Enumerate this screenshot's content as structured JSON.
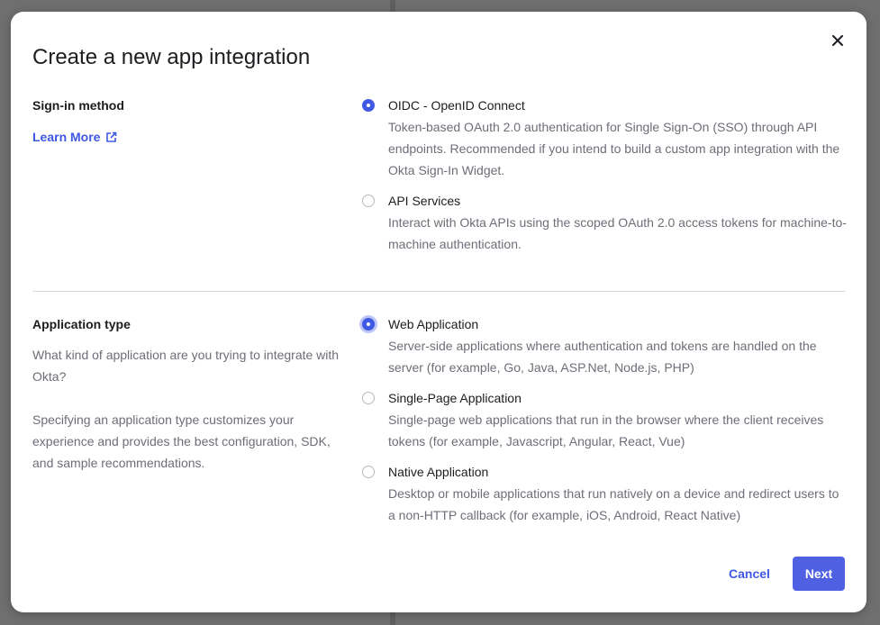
{
  "modal": {
    "title": "Create a new app integration",
    "close_icon": "close-icon"
  },
  "sign_in": {
    "label": "Sign-in method",
    "learn_more": "Learn More",
    "learn_more_icon": "external-link-icon",
    "options": [
      {
        "title": "OIDC - OpenID Connect",
        "description": "Token-based OAuth 2.0 authentication for Single Sign-On (SSO) through API endpoints. Recommended if you intend to build a custom app integration with the Okta Sign-In Widget.",
        "checked": true
      },
      {
        "title": "API Services",
        "description": "Interact with Okta APIs using the scoped OAuth 2.0 access tokens for machine-to-machine authentication.",
        "checked": false
      }
    ]
  },
  "app_type": {
    "label": "Application type",
    "help_1": "What kind of application are you trying to integrate with Okta?",
    "help_2": "Specifying an application type customizes your experience and provides the best configuration, SDK, and sample recommendations.",
    "options": [
      {
        "title": "Web Application",
        "description": "Server-side applications where authentication and tokens are handled on the server (for example, Go, Java, ASP.Net, Node.js, PHP)",
        "checked": true
      },
      {
        "title": "Single-Page Application",
        "description": "Single-page web applications that run in the browser where the client receives tokens (for example, Javascript, Angular, React, Vue)",
        "checked": false
      },
      {
        "title": "Native Application",
        "description": "Desktop or mobile applications that run natively on a device and redirect users to a non-HTTP callback (for example, iOS, Android, React Native)",
        "checked": false
      }
    ]
  },
  "footer": {
    "cancel_label": "Cancel",
    "next_label": "Next"
  },
  "colors": {
    "accent": "#3f59e4",
    "primary_button": "#4f60e3",
    "text_primary": "#1d1d21",
    "text_secondary": "#6e6e78"
  }
}
